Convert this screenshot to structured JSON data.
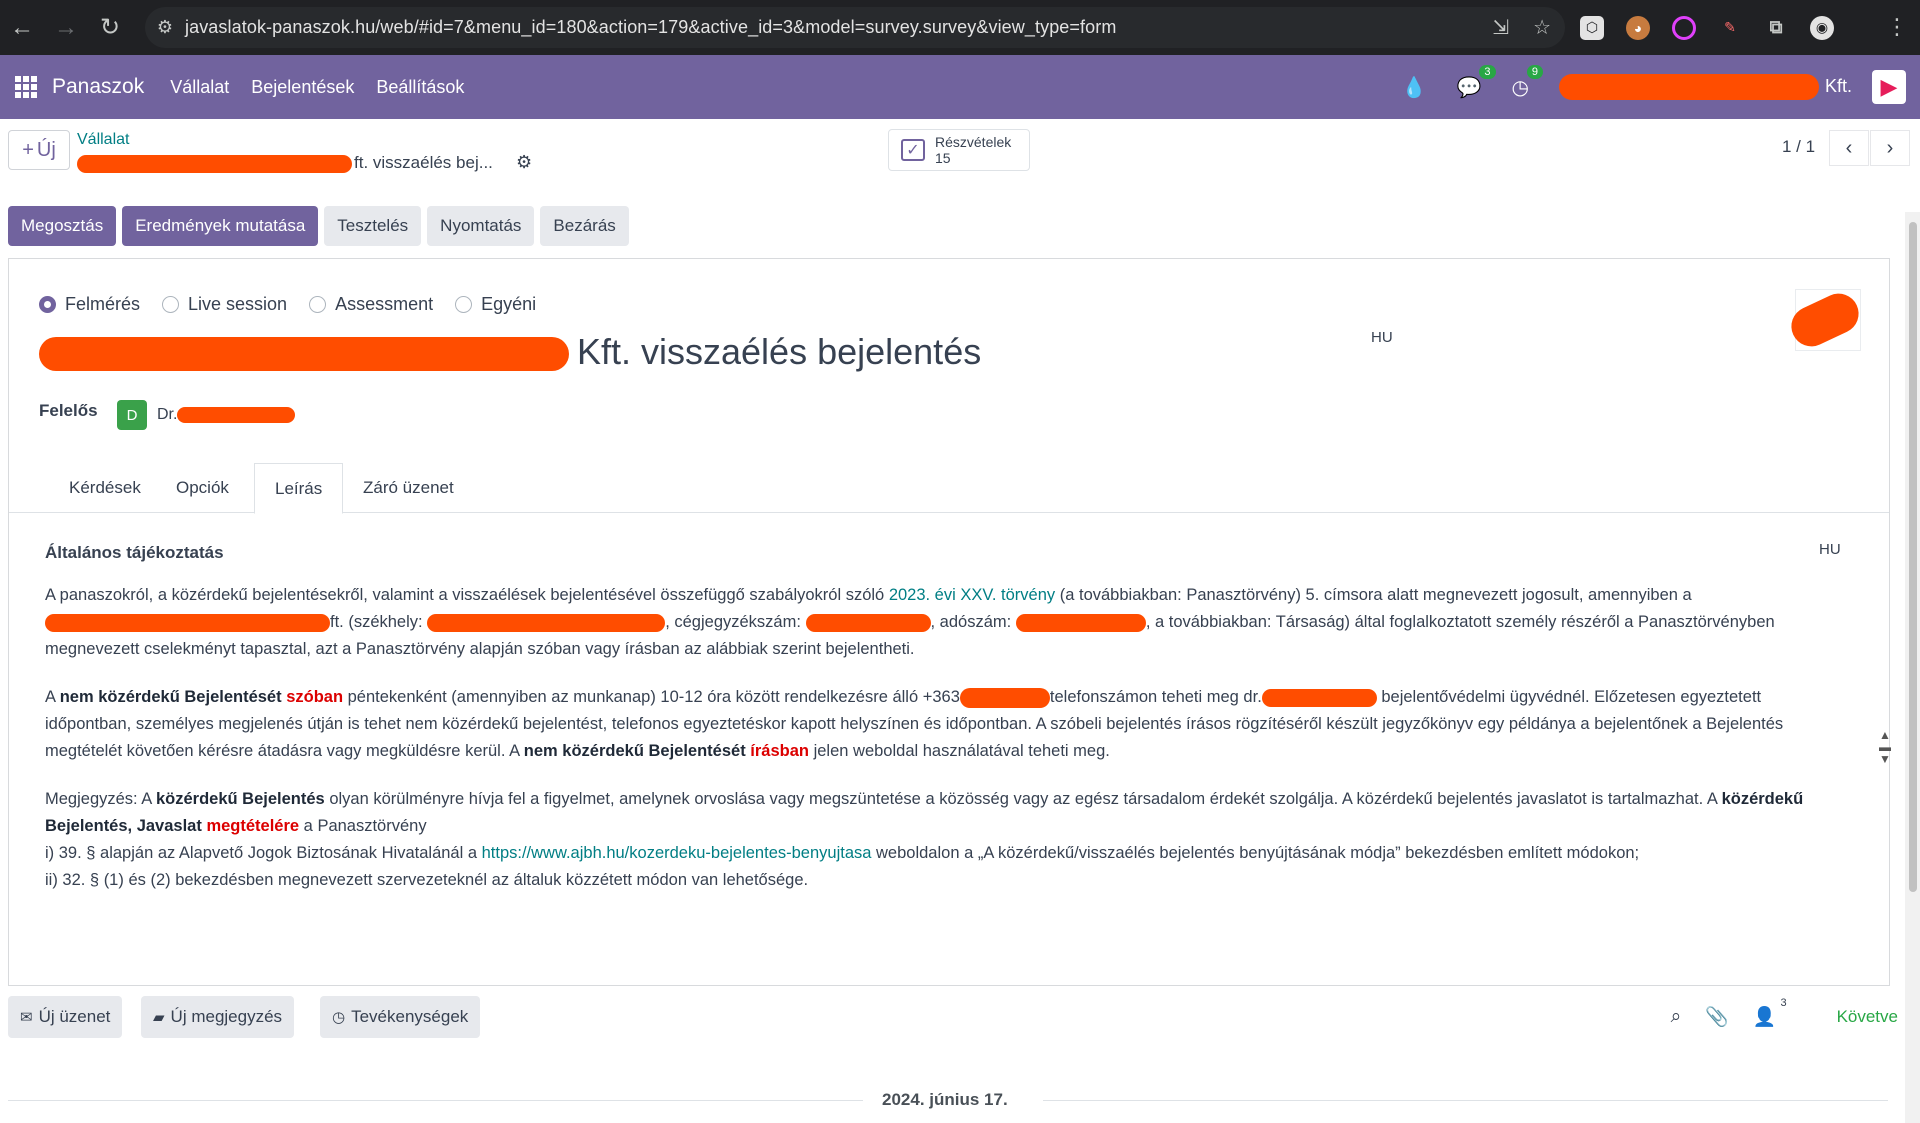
{
  "browser": {
    "url": "javaslatok-panaszok.hu/web/#id=7&menu_id=180&action=179&active_id=3&model=survey.survey&view_type=form"
  },
  "navbar": {
    "brand": "Panaszok",
    "menus": [
      "Vállalat",
      "Bejelentések",
      "Beállítások"
    ],
    "messages_count": "3",
    "activities_count": "9",
    "company_suffix": "Kft."
  },
  "control": {
    "new_label": "Új",
    "breadcrumb_parent": "Vállalat",
    "breadcrumb_current": "ft. visszaélés bej...",
    "stat_label": "Részvételek",
    "stat_value": "15",
    "pager": "1 / 1"
  },
  "header_buttons": [
    "Megosztás",
    "Eredmények mutatása",
    "Tesztelés",
    "Nyomtatás",
    "Bezárás"
  ],
  "form": {
    "survey_types": [
      {
        "label": "Felmérés",
        "checked": true
      },
      {
        "label": "Live session",
        "checked": false
      },
      {
        "label": "Assessment",
        "checked": false
      },
      {
        "label": "Egyéni",
        "checked": false
      }
    ],
    "title_visible": "Kft. visszaélés bejelentés",
    "lang": "HU",
    "responsible_label": "Felelős",
    "responsible_initial": "D",
    "responsible_name": "Dr."
  },
  "tabs": [
    "Kérdések",
    "Opciók",
    "Leírás",
    "Záró üzenet"
  ],
  "description": {
    "heading": "Általános tájékoztatás",
    "lang": "HU",
    "p1_a": "A panaszokról, a közérdekű bejelentésekről, valamint a visszaélések bejelentésével összefüggő szabályokról szóló ",
    "p1_link": "2023. évi XXV. törvény",
    "p1_b": " (a továbbiakban: Panasztörvény) 5. címsora alatt megnevezett jogosult, amennyiben a ",
    "p1_c": "ft. (székhely: ",
    "p1_d": ", cégjegyzékszám: ",
    "p1_e": ", adószám: ",
    "p1_f": ", a továbbiakban: Társaság) által foglalkoztatott személy részéről a Panasztörvényben megnevezett cselekményt tapasztal, azt a Panasztörvény alapján szóban vagy írásban az alábbiak szerint bejelentheti.",
    "p2_a": "A ",
    "p2_b1": "nem közérdekű Bejelentését",
    "p2_r1": "szóban",
    "p2_c": " péntekenként (amennyiben az munkanap) 10-12 óra között rendelkezésre álló +363",
    "p2_d": "telefonszámon teheti meg dr.",
    "p2_e": " bejelentővédelmi ügyvédnél. Előzetesen egyeztetett időpontban, személyes megjelenés útján is tehet nem közérdekű bejelentést, telefonos egyeztetéskor kapott helyszínen és időpontban. A szóbeli bejelentés írásos rögzítéséről készült jegyzőkönyv egy példánya a bejelentőnek a Bejelentés megtételét követően kérésre átadásra vagy megküldésre kerül. A ",
    "p2_b2": "nem közérdekű Bejelentését",
    "p2_r2": "írásban",
    "p2_f": " jelen weboldal használatával teheti meg.",
    "p3_a": "Megjegyzés: A ",
    "p3_b1": "közérdekű Bejelentés",
    "p3_c": " olyan körülményre hívja fel a figyelmet, amelynek orvoslása vagy megszüntetése a közösség vagy az egész társadalom érdekét szolgálja. A közérdekű bejelentés javaslatot is tartalmazhat. A ",
    "p3_b2": "közérdekű Bejelentés, Javaslat",
    "p3_r": "megtételére",
    "p3_d": " a Panasztörvény",
    "p3_i_a": "i) 39. § alapján az Alapvető Jogok Biztosának Hivatalánál  a ",
    "p3_i_link": "https://www.ajbh.hu/kozerdeku-bejelentes-benyujtasa",
    "p3_i_b": "  weboldalon a „A közérdekű/visszaélés bejelentés benyújtásának módja” bekezdésben említett módokon;",
    "p3_ii": "ii) 32. § (1) és (2) bekezdésben megnevezett szervezeteknél az általuk közzétett módon van lehetősége."
  },
  "chatter": {
    "send_message": "Új üzenet",
    "log_note": "Új megjegyzés",
    "activities": "Tevékenységek",
    "followers_count": "3",
    "following": "Követve",
    "date": "2024. június 17."
  }
}
